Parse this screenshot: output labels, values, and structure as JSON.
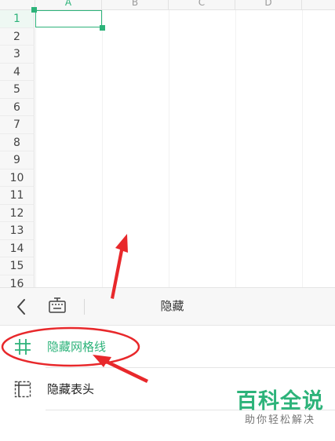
{
  "sheet": {
    "columns": [
      {
        "label": "A",
        "active": true
      },
      {
        "label": "B",
        "active": false
      },
      {
        "label": "C",
        "active": false
      },
      {
        "label": "D",
        "active": false
      },
      {
        "label": "",
        "active": false
      }
    ],
    "rows": [
      "1",
      "2",
      "3",
      "4",
      "5",
      "6",
      "7",
      "8",
      "9",
      "10",
      "11",
      "12",
      "13",
      "14",
      "15",
      "16"
    ],
    "active_row": "1",
    "accent_color": "#2db37a"
  },
  "panel": {
    "title": "隐藏",
    "back_icon": "chevron-left-icon",
    "keyboard_icon": "keyboard-icon",
    "items": [
      {
        "label": "隐藏网格线",
        "icon": "grid-icon",
        "active": true
      },
      {
        "label": "隐藏表头",
        "icon": "header-table-icon",
        "active": false
      }
    ]
  },
  "watermark": {
    "main": "百科全说",
    "sub": "助你轻松解决"
  }
}
